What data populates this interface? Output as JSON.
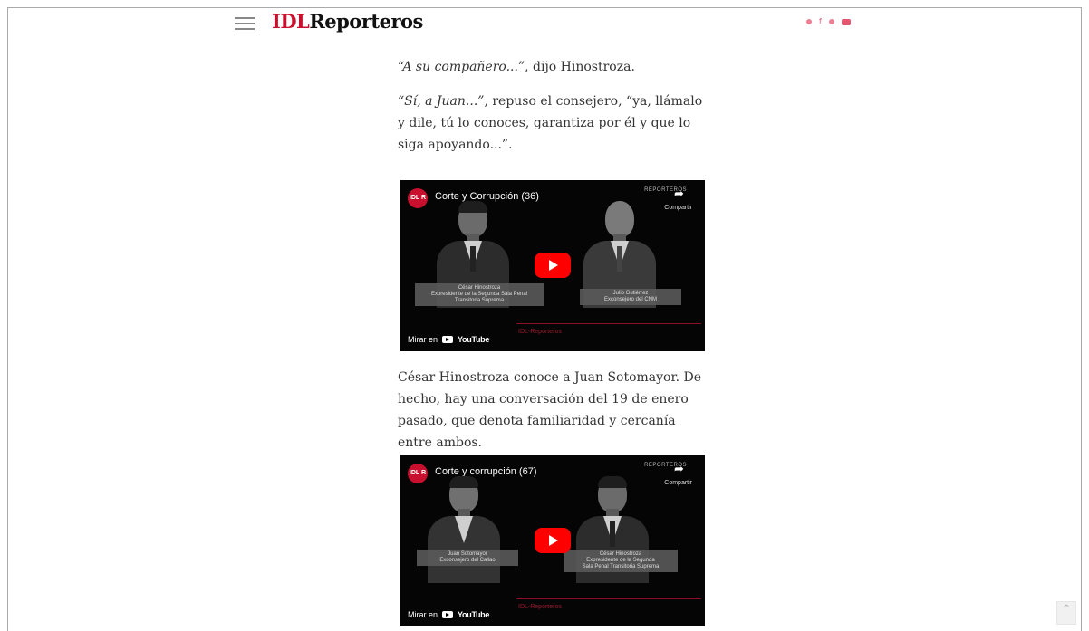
{
  "header": {
    "logo_idl": "IDL",
    "logo_rest": "Reporteros",
    "social_icons": [
      "twitter-icon",
      "facebook-icon",
      "instagram-icon",
      "youtube-icon"
    ],
    "brand_color": "#c8102e"
  },
  "article": {
    "p1_quote": "“A su compañero...”",
    "p1_rest": ", dijo Hinostroza.",
    "p2_quote": "“Sí, a Juan...”",
    "p2_rest": ", repuso el consejero, “ya, llámalo y dile, tú lo conoces, garantiza por él y que lo siga apoyando...”.",
    "p3": "César Hinostroza conoce a Juan Sotomayor. De hecho, hay una conversación del 19 de enero pasado, que denota familiaridad y cercanía entre ambos."
  },
  "videos": [
    {
      "channel_badge": "IDL R",
      "title": "Corte y Corrupción (36)",
      "brand": "REPORTEROS",
      "share_label": "Compartir",
      "left_caption": "César Hinostroza\nExpresidente de la Segunda Sala Penal\nTransitoria Suprema",
      "right_caption": "Julio Gutiérrez\nExconsejero del CNM",
      "credit": "IDL-Reporteros",
      "watch_on": "Mirar en",
      "youtube_label": "YouTube"
    },
    {
      "channel_badge": "IDL R",
      "title": "Corte y corrupción (67)",
      "brand": "REPORTEROS",
      "share_label": "Compartir",
      "left_caption": "Juan Sotomayor\nExconsejero del Callao",
      "right_caption": "César Hinostroza\nExpresidente de la Segunda\nSala Penal Transitoria Suprema",
      "credit": "IDL-Reporteros",
      "watch_on": "Mirar en",
      "youtube_label": "YouTube"
    }
  ]
}
